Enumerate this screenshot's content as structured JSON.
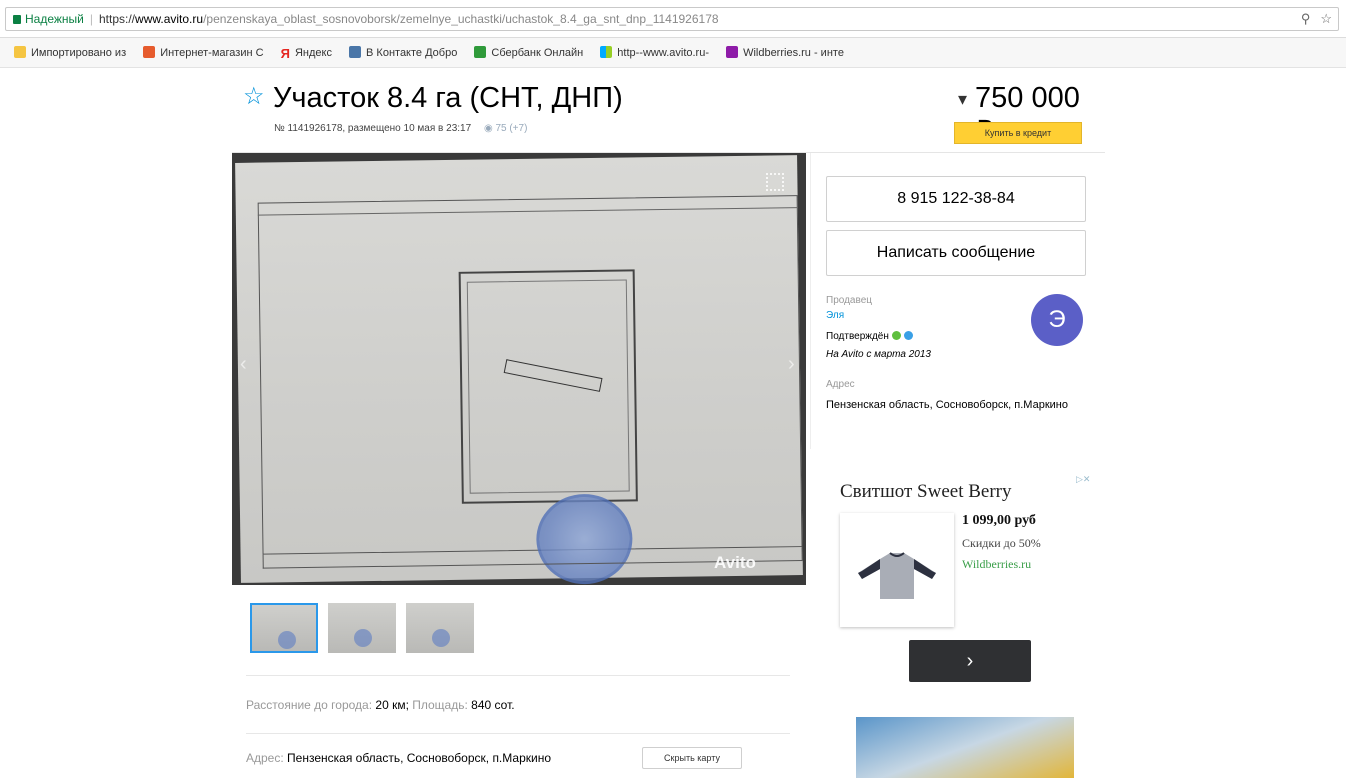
{
  "browser": {
    "security_label": "Надежный",
    "url_scheme": "https://",
    "url_host": "www.avito.ru",
    "url_path": "/penzenskaya_oblast_sosnovoborsk/zemelnye_uchastki/uchastok_8.4_ga_snt_dnp_1141926178",
    "icons": [
      "zoom-icon",
      "star-icon"
    ]
  },
  "bookmarks": [
    {
      "label": "Импортировано из ",
      "icon": "folder-icon"
    },
    {
      "label": "Интернет-магазин С",
      "icon": "shop-icon"
    },
    {
      "label": "Яндекс",
      "icon": "yandex-icon"
    },
    {
      "label": "В Контакте  Добро",
      "icon": "vk-icon"
    },
    {
      "label": "Сбербанк Онлайн",
      "icon": "sber-icon"
    },
    {
      "label": "http--www.avito.ru-",
      "icon": "avito-icon"
    },
    {
      "label": "Wildberries.ru - инте",
      "icon": "wildberries-icon"
    }
  ],
  "listing": {
    "title": "Участок 8.4 га (СНТ, ДНП)",
    "meta": "№ 1141926178, размещено 10 мая в 23:17",
    "views": "75 (+7)",
    "price": "750 000 ₽",
    "credit_button": "Купить в кредит",
    "watermark": "Avito",
    "thumbnails_count": 3,
    "params": {
      "distance_label": "Расстояние до города:",
      "distance_value": "20 км",
      "area_label": "Площадь:",
      "area_value": "840 сот."
    },
    "address_label": "Адрес:",
    "address_value": "Пензенская область, Сосновоборск, п.Маркино",
    "hide_map_button": "Скрыть карту"
  },
  "seller": {
    "phone": "8 915 122-38-84",
    "message_button": "Написать сообщение",
    "label": "Продавец",
    "name": "Эля",
    "verified": "Подтверждён",
    "since": "На Avito с марта 2013",
    "avatar_letter": "Э",
    "address_label": "Адрес",
    "address": "Пензенская область, Сосновоборск, п.Маркино"
  },
  "ad": {
    "title": "Свитшот Sweet Berry",
    "price": "1 099,00 руб",
    "discount": "Скидки до 50%",
    "site": "Wildberries.ru",
    "next_label": "›"
  },
  "colors": {
    "accent": "#0091d9",
    "credit": "#ffcf33",
    "avatar": "#5b5fc7",
    "secure": "#0b8043"
  }
}
